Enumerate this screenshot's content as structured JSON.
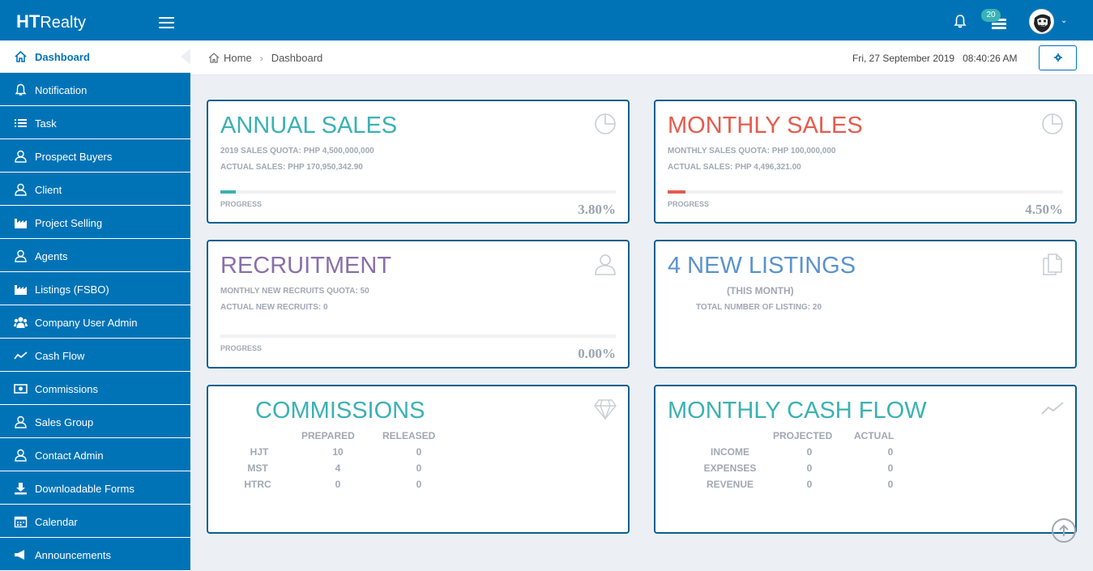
{
  "header": {
    "brand_bold": "HT",
    "brand_rest": "Realty",
    "notification_count": "20",
    "colors": {
      "primary": "#0073b7",
      "badge": "#39b3b5"
    }
  },
  "sidebar": {
    "items": [
      {
        "label": "Dashboard",
        "icon": "home-icon",
        "active": true
      },
      {
        "label": "Notification",
        "icon": "bell-icon"
      },
      {
        "label": "Task",
        "icon": "list-icon"
      },
      {
        "label": "Prospect Buyers",
        "icon": "user-icon"
      },
      {
        "label": "Client",
        "icon": "user-icon"
      },
      {
        "label": "Project Selling",
        "icon": "factory-icon"
      },
      {
        "label": "Agents",
        "icon": "user-icon"
      },
      {
        "label": "Listings (FSBO)",
        "icon": "factory-icon"
      },
      {
        "label": "Company User Admin",
        "icon": "users-icon"
      },
      {
        "label": "Cash Flow",
        "icon": "line-chart-icon"
      },
      {
        "label": "Commissions",
        "icon": "money-icon"
      },
      {
        "label": "Sales Group",
        "icon": "user-icon"
      },
      {
        "label": "Contact Admin",
        "icon": "user-icon"
      },
      {
        "label": "Downloadable Forms",
        "icon": "download-icon"
      },
      {
        "label": "Calendar",
        "icon": "calendar-icon"
      },
      {
        "label": "Announcements",
        "icon": "megaphone-icon"
      }
    ]
  },
  "breadcrumb": {
    "home": "Home",
    "current": "Dashboard"
  },
  "datetime": {
    "date": "Fri, 27 September 2019",
    "time": "08:40:26 AM"
  },
  "cards": {
    "annual": {
      "title": "ANNUAL SALES",
      "quota": "2019 SALES QUOTA: PHP 4,500,000,000",
      "actual": "ACTUAL SALES: PHP 170,950,342.90",
      "progress_label": "PROGRESS",
      "percent": "3.80%",
      "progress_fraction": 0.038,
      "color": "#3bb1b3",
      "icon": "pie-chart-icon"
    },
    "monthly": {
      "title": "MONTHLY SALES",
      "quota": "MONTHLY SALES QUOTA: PHP 100,000,000",
      "actual": "ACTUAL SALES: PHP 4,496,321.00",
      "progress_label": "PROGRESS",
      "percent": "4.50%",
      "progress_fraction": 0.045,
      "color": "#e45c4e",
      "icon": "pie-chart-icon"
    },
    "recruitment": {
      "title": "RECRUITMENT",
      "quota": "MONTHLY NEW RECRUITS QUOTA: 50",
      "actual": "ACTUAL NEW RECRUITS: 0",
      "progress_label": "PROGRESS",
      "percent": "0.00%",
      "progress_fraction": 0.0,
      "color": "#8a6fa8",
      "icon": "user-outline-icon"
    },
    "listings": {
      "title": "4 NEW LISTINGS",
      "subtitle": "(THIS MONTH)",
      "total": "TOTAL NUMBER OF LISTING: 20",
      "color": "#5b93cc",
      "icon": "documents-icon"
    },
    "commissions": {
      "title": "COMMISSIONS",
      "headers": [
        "PREPARED",
        "RELEASED"
      ],
      "rows": [
        {
          "name": "HJT",
          "prepared": "10",
          "released": "0"
        },
        {
          "name": "MST",
          "prepared": "4",
          "released": "0"
        },
        {
          "name": "HTRC",
          "prepared": "0",
          "released": "0"
        }
      ],
      "color": "#3bb1b3",
      "icon": "diamond-icon"
    },
    "cashflow": {
      "title": "MONTHLY CASH FLOW",
      "headers": [
        "PROJECTED",
        "ACTUAL"
      ],
      "rows": [
        {
          "name": "INCOME",
          "projected": "0",
          "actual": "0"
        },
        {
          "name": "EXPENSES",
          "projected": "0",
          "actual": "0"
        },
        {
          "name": "REVENUE",
          "projected": "0",
          "actual": "0"
        }
      ],
      "color": "#3bb1b3",
      "icon": "trend-line-icon"
    }
  }
}
